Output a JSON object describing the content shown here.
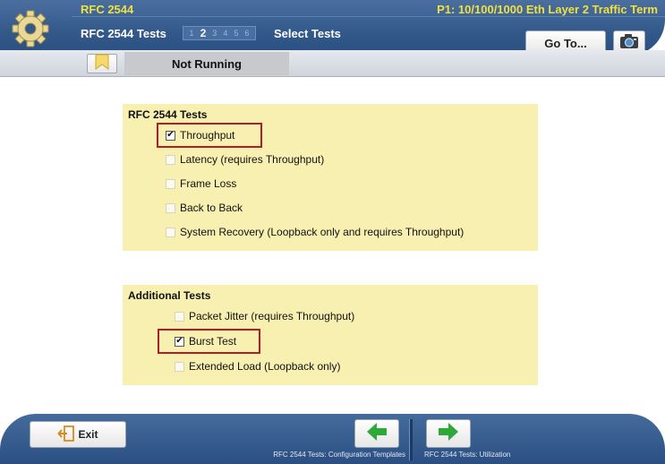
{
  "header": {
    "app_title": "RFC 2544",
    "port_title": "P1: 10/100/1000 Eth Layer 2 Traffic Term",
    "sub_title": "RFC 2544 Tests",
    "steps": [
      "1",
      "2",
      "3",
      "4",
      "5",
      "6"
    ],
    "current_step": "2",
    "step_title": "Select Tests",
    "goto_label": "Go To...",
    "gear_icon": "gear-icon",
    "camera_icon": "camera-icon"
  },
  "status": {
    "text": "Not Running",
    "flag_icon": "flag-icon"
  },
  "rfc_panel": {
    "title": "RFC 2544 Tests",
    "options": [
      {
        "label": "Throughput",
        "checked": true
      },
      {
        "label": "Latency (requires Throughput)",
        "checked": false
      },
      {
        "label": "Frame Loss",
        "checked": false
      },
      {
        "label": "Back to Back",
        "checked": false
      },
      {
        "label": "System Recovery (Loopback only and requires Throughput)",
        "checked": false
      }
    ]
  },
  "additional_panel": {
    "title": "Additional Tests",
    "options": [
      {
        "label": "Packet Jitter (requires Throughput)",
        "checked": false
      },
      {
        "label": "Burst Test",
        "checked": true
      },
      {
        "label": "Extended Load (Loopback only)",
        "checked": false
      }
    ]
  },
  "footer": {
    "exit_label": "Exit",
    "back_label": "RFC 2544 Tests: Configuration Templates",
    "next_label": "RFC 2544 Tests: Utilization"
  },
  "colors": {
    "header_blue": "#345a8c",
    "title_yellow": "#f0e040",
    "panel_yellow": "#f8f0b0",
    "highlight_red": "#b01e24",
    "arrow_green": "#2fa83a"
  }
}
